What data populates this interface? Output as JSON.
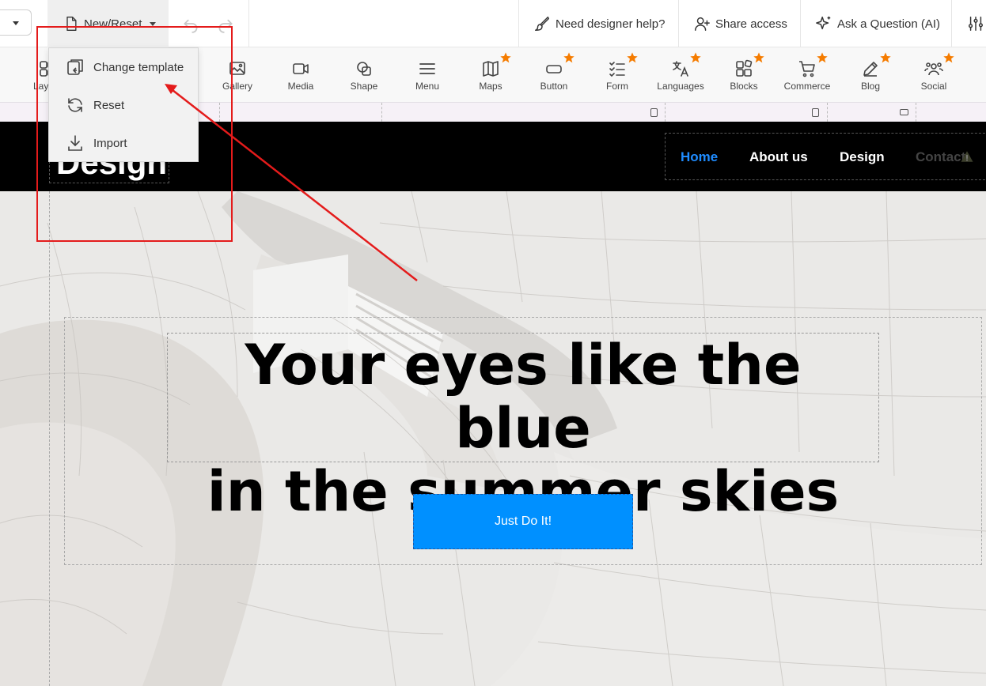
{
  "topbar": {
    "new_reset_label": "New/Reset",
    "designer_help_label": "Need designer help?",
    "share_access_label": "Share access",
    "ask_question_label": "Ask a Question (AI)"
  },
  "toolbar": {
    "items": [
      {
        "label": "Layout",
        "icon": "layout-icon",
        "premium": false
      },
      {
        "label": "Gallery",
        "icon": "gallery-icon",
        "premium": false
      },
      {
        "label": "Media",
        "icon": "video-icon",
        "premium": false
      },
      {
        "label": "Shape",
        "icon": "shape-icon",
        "premium": false
      },
      {
        "label": "Menu",
        "icon": "menu-icon",
        "premium": false
      },
      {
        "label": "Maps",
        "icon": "map-icon",
        "premium": true
      },
      {
        "label": "Button",
        "icon": "button-icon",
        "premium": true
      },
      {
        "label": "Form",
        "icon": "form-icon",
        "premium": true
      },
      {
        "label": "Languages",
        "icon": "translate-icon",
        "premium": true
      },
      {
        "label": "Blocks",
        "icon": "blocks-icon",
        "premium": true
      },
      {
        "label": "Commerce",
        "icon": "cart-icon",
        "premium": true
      },
      {
        "label": "Blog",
        "icon": "pen-icon",
        "premium": true
      },
      {
        "label": "Social",
        "icon": "people-icon",
        "premium": true
      }
    ],
    "star_color": "#f57c00"
  },
  "dropdown": {
    "items": [
      {
        "label": "Change template",
        "icon": "change-template-icon"
      },
      {
        "label": "Reset",
        "icon": "refresh-icon"
      },
      {
        "label": "Import",
        "icon": "download-icon"
      }
    ]
  },
  "site": {
    "logo_text": "Design",
    "nav": [
      {
        "label": "Home",
        "active": true
      },
      {
        "label": "About us",
        "active": false
      },
      {
        "label": "Design",
        "active": false
      },
      {
        "label": "Contact",
        "active": false
      }
    ],
    "headline_line1": "Your eyes like the blue",
    "headline_line2": "in the summer skies",
    "cta_label": "Just Do It!",
    "accent_color": "#0090ff",
    "nav_active_color": "#1f8cff"
  },
  "annotation": {
    "color": "#e41b1b"
  }
}
